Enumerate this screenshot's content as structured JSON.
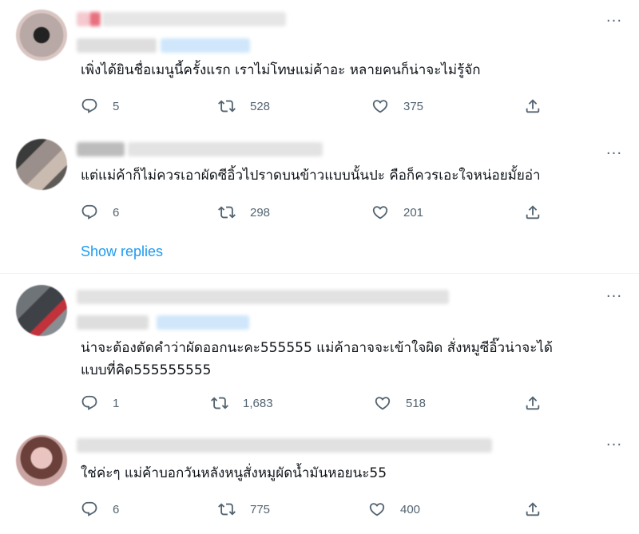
{
  "tweets": [
    {
      "text": "เพิ่งได้ยินชื่อเมนูนี้ครั้งแรก เราไม่โทษแม่ค้าอะ หลายคนก็น่าจะไม่รู้จัก",
      "replies": "5",
      "retweets": "528",
      "likes": "375",
      "more": "···"
    },
    {
      "text": "แต่แม่ค้าก็ไม่ควรเอาผัดซีอิ้วไปราดบนข้าวแบบนั้นปะ คือก็ควรเอะใจหน่อยมั้ยอ่า",
      "replies": "6",
      "retweets": "298",
      "likes": "201",
      "more": "···"
    },
    {
      "text": "น่าจะต้องตัดคำว่าผัดออกนะคะ555555 แม่ค้าอาจจะเข้าใจผิด สั่งหมูซีอิ๊วน่าจะได้\nแบบที่คิด555555555",
      "replies": "1",
      "retweets": "1,683",
      "likes": "518",
      "more": "···"
    },
    {
      "text": "ใช่ค่ะๆ แม่ค้าบอกวันหลังหนูสั่งหมูผัดน้ำมันหอยนะ55",
      "replies": "6",
      "retweets": "775",
      "likes": "400",
      "more": "···"
    }
  ],
  "show_replies": "Show replies",
  "colors": {
    "icon": "#536471",
    "link": "#1d9bf0",
    "text": "#0f1419",
    "divider": "#eff3f4"
  }
}
